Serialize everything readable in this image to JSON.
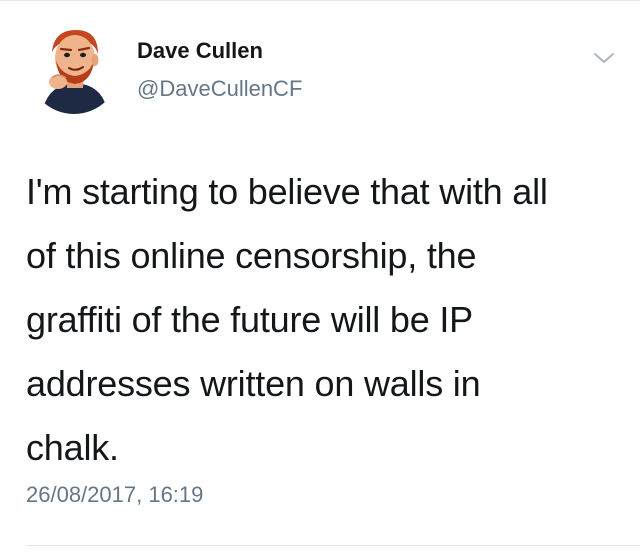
{
  "tweet": {
    "author": {
      "display_name": "Dave Cullen",
      "handle": "@DaveCullenCF",
      "avatar_icon": "cartoon-avatar-icon"
    },
    "menu_icon": "chevron-down-icon",
    "text": "I'm starting to believe that with all\nof this online censorship, the\ngraffiti of the future will be IP\naddresses written on walls in\nchalk.",
    "timestamp": "26/08/2017, 16:19"
  },
  "colors": {
    "text_primary": "#14171a",
    "text_secondary": "#657786",
    "divider": "#e1e8ed",
    "chevron": "#aab8c2"
  }
}
